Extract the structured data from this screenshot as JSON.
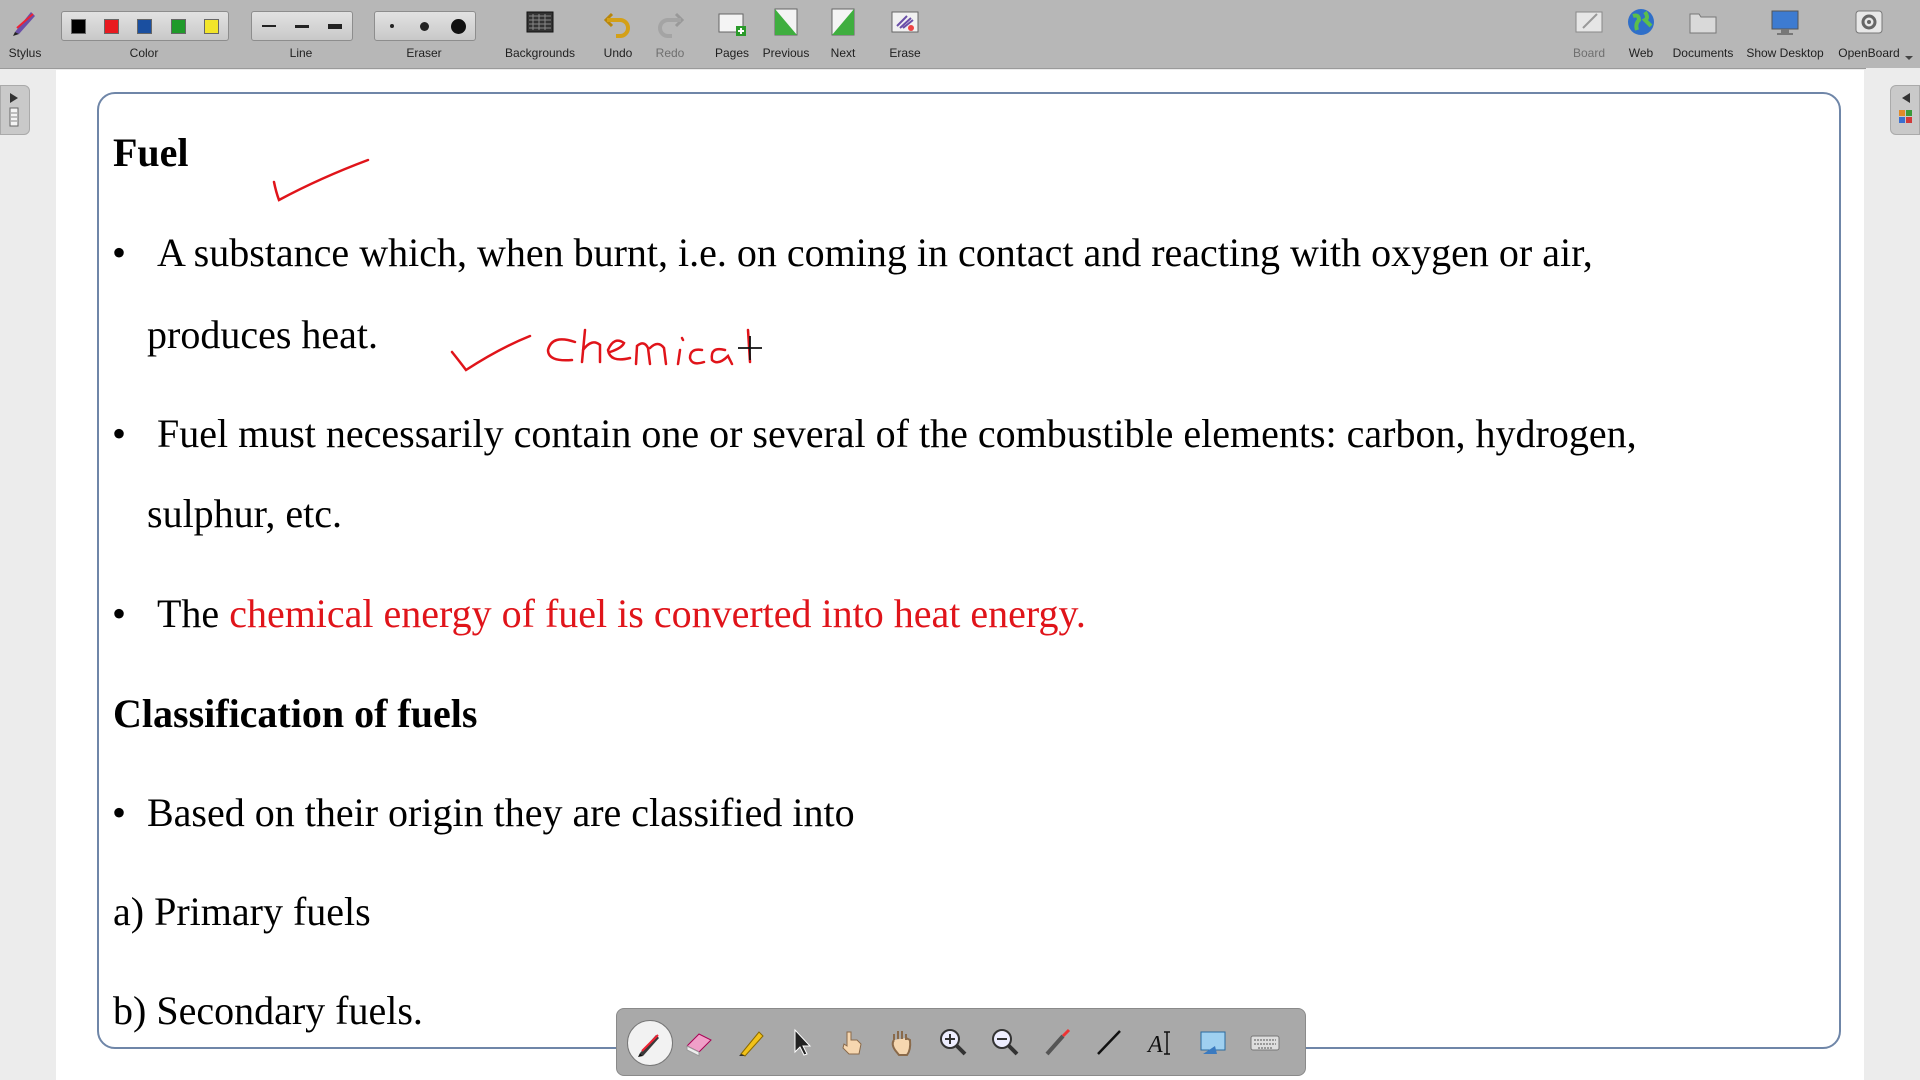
{
  "toolbar": {
    "stylus": "Stylus",
    "color": "Color",
    "line": "Line",
    "eraser": "Eraser",
    "backgrounds": "Backgrounds",
    "undo": "Undo",
    "redo": "Redo",
    "pages": "Pages",
    "previous": "Previous",
    "next": "Next",
    "erase": "Erase",
    "board": "Board",
    "web": "Web",
    "documents": "Documents",
    "show_desktop": "Show Desktop",
    "openboard": "OpenBoard",
    "colors": [
      "#000000",
      "#e8191f",
      "#1a4fa0",
      "#1f9a2a",
      "#f2e52a"
    ]
  },
  "content": {
    "heading1": "Fuel",
    "bullet1_line1": "A substance which, when burnt, i.e. on coming in contact and reacting with oxygen or air,",
    "bullet1_line2": "produces heat.",
    "bullet2_line1": "Fuel must necessarily contain one or several of the combustible elements: carbon, hydrogen,",
    "bullet2_line2": "sulphur, etc.",
    "bullet3_prefix": "The",
    "bullet3_red": "chemical energy of fuel is converted into heat energy.",
    "heading2": "Classification of fuels",
    "bullet4": "Based on their origin they are classified into",
    "item_a": "a) Primary fuels",
    "item_b": "b) Secondary fuels.",
    "bullet_char": "•"
  },
  "annotations": {
    "handwriting": "chemical",
    "ink_color": "#e0141a"
  },
  "bottom_tools": [
    "pen-icon",
    "eraser-icon",
    "highlighter-icon",
    "selector-icon",
    "interact-icon",
    "hand-icon",
    "zoom-in-icon",
    "zoom-out-icon",
    "laser-icon",
    "line-icon",
    "text-icon",
    "capture-icon",
    "keyboard-icon"
  ]
}
